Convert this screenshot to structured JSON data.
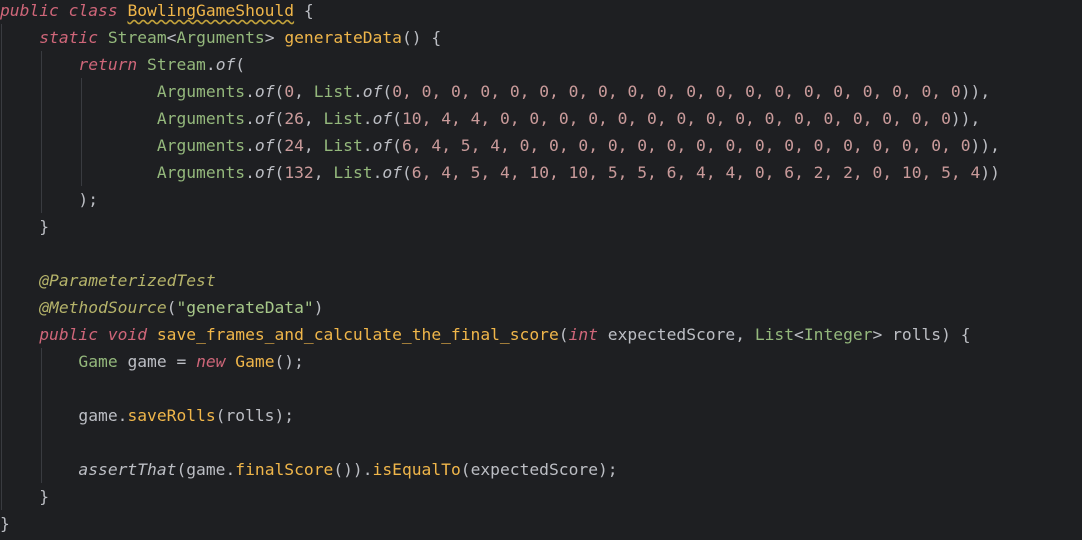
{
  "editor": {
    "colors": {
      "background": "#1e1f22",
      "plain": "#bcbec4",
      "keyword": "#cf6679",
      "type": "#94b87c",
      "method": "#f0b64a",
      "number": "#c99a9a",
      "annotation": "#b5b36a",
      "string": "#a8c98a",
      "indent_guide": "#393b40"
    },
    "lines": [
      {
        "tokens": [
          {
            "t": "public class ",
            "c": "keyword"
          },
          {
            "t": "BowlingGameShould",
            "c": "method",
            "classref": true
          },
          {
            "t": " {",
            "c": "plain"
          }
        ]
      },
      {
        "tokens": [
          {
            "t": "    ",
            "c": "plain"
          },
          {
            "t": "static ",
            "c": "keyword"
          },
          {
            "t": "Stream",
            "c": "type"
          },
          {
            "t": "<",
            "c": "plain"
          },
          {
            "t": "Arguments",
            "c": "type"
          },
          {
            "t": "> ",
            "c": "plain"
          },
          {
            "t": "generateData",
            "c": "method"
          },
          {
            "t": "() {",
            "c": "plain"
          }
        ]
      },
      {
        "tokens": [
          {
            "t": "        ",
            "c": "plain"
          },
          {
            "t": "return ",
            "c": "keyword"
          },
          {
            "t": "Stream",
            "c": "type"
          },
          {
            "t": ".",
            "c": "plain"
          },
          {
            "t": "of",
            "c": "plain",
            "italic": true
          },
          {
            "t": "(",
            "c": "plain"
          }
        ]
      },
      {
        "tokens": [
          {
            "t": "                ",
            "c": "plain"
          },
          {
            "t": "Arguments",
            "c": "type"
          },
          {
            "t": ".",
            "c": "plain"
          },
          {
            "t": "of",
            "c": "plain",
            "italic": true
          },
          {
            "t": "(",
            "c": "plain"
          },
          {
            "t": "0",
            "c": "number"
          },
          {
            "t": ", ",
            "c": "plain"
          },
          {
            "t": "List",
            "c": "type"
          },
          {
            "t": ".",
            "c": "plain"
          },
          {
            "t": "of",
            "c": "plain",
            "italic": true
          },
          {
            "t": "(",
            "c": "plain"
          },
          {
            "t": "0, 0, 0, 0, 0, 0, 0, 0, 0, 0, 0, 0, 0, 0, 0, 0, 0, 0, 0, 0",
            "c": "number"
          },
          {
            "t": ")),",
            "c": "plain"
          }
        ]
      },
      {
        "tokens": [
          {
            "t": "                ",
            "c": "plain"
          },
          {
            "t": "Arguments",
            "c": "type"
          },
          {
            "t": ".",
            "c": "plain"
          },
          {
            "t": "of",
            "c": "plain",
            "italic": true
          },
          {
            "t": "(",
            "c": "plain"
          },
          {
            "t": "26",
            "c": "number"
          },
          {
            "t": ", ",
            "c": "plain"
          },
          {
            "t": "List",
            "c": "type"
          },
          {
            "t": ".",
            "c": "plain"
          },
          {
            "t": "of",
            "c": "plain",
            "italic": true
          },
          {
            "t": "(",
            "c": "plain"
          },
          {
            "t": "10, 4, 4, 0, 0, 0, 0, 0, 0, 0, 0, 0, 0, 0, 0, 0, 0, 0, 0",
            "c": "number"
          },
          {
            "t": ")),",
            "c": "plain"
          }
        ]
      },
      {
        "tokens": [
          {
            "t": "                ",
            "c": "plain"
          },
          {
            "t": "Arguments",
            "c": "type"
          },
          {
            "t": ".",
            "c": "plain"
          },
          {
            "t": "of",
            "c": "plain",
            "italic": true
          },
          {
            "t": "(",
            "c": "plain"
          },
          {
            "t": "24",
            "c": "number"
          },
          {
            "t": ", ",
            "c": "plain"
          },
          {
            "t": "List",
            "c": "type"
          },
          {
            "t": ".",
            "c": "plain"
          },
          {
            "t": "of",
            "c": "plain",
            "italic": true
          },
          {
            "t": "(",
            "c": "plain"
          },
          {
            "t": "6, 4, 5, 4, 0, 0, 0, 0, 0, 0, 0, 0, 0, 0, 0, 0, 0, 0, 0, 0",
            "c": "number"
          },
          {
            "t": ")),",
            "c": "plain"
          }
        ]
      },
      {
        "tokens": [
          {
            "t": "                ",
            "c": "plain"
          },
          {
            "t": "Arguments",
            "c": "type"
          },
          {
            "t": ".",
            "c": "plain"
          },
          {
            "t": "of",
            "c": "plain",
            "italic": true
          },
          {
            "t": "(",
            "c": "plain"
          },
          {
            "t": "132",
            "c": "number"
          },
          {
            "t": ", ",
            "c": "plain"
          },
          {
            "t": "List",
            "c": "type"
          },
          {
            "t": ".",
            "c": "plain"
          },
          {
            "t": "of",
            "c": "plain",
            "italic": true
          },
          {
            "t": "(",
            "c": "plain"
          },
          {
            "t": "6, 4, 5, 4, 10, 10, 5, 5, 6, 4, 4, 0, 6, 2, 2, 0, 10, 5, 4",
            "c": "number"
          },
          {
            "t": "))",
            "c": "plain"
          }
        ]
      },
      {
        "tokens": [
          {
            "t": "        );",
            "c": "plain"
          }
        ]
      },
      {
        "tokens": [
          {
            "t": "    }",
            "c": "plain"
          }
        ]
      },
      {
        "tokens": []
      },
      {
        "tokens": [
          {
            "t": "    ",
            "c": "plain"
          },
          {
            "t": "@ParameterizedTest",
            "c": "annotation",
            "italic": true
          }
        ]
      },
      {
        "tokens": [
          {
            "t": "    ",
            "c": "plain"
          },
          {
            "t": "@MethodSource",
            "c": "annotation",
            "italic": true
          },
          {
            "t": "(",
            "c": "plain"
          },
          {
            "t": "\"generateData\"",
            "c": "string"
          },
          {
            "t": ")",
            "c": "plain"
          }
        ]
      },
      {
        "tokens": [
          {
            "t": "    ",
            "c": "plain"
          },
          {
            "t": "public void ",
            "c": "keyword"
          },
          {
            "t": "save_frames_and_calculate_the_final_score",
            "c": "method"
          },
          {
            "t": "(",
            "c": "plain"
          },
          {
            "t": "int ",
            "c": "keyword"
          },
          {
            "t": "expectedScore, ",
            "c": "plain"
          },
          {
            "t": "List",
            "c": "type"
          },
          {
            "t": "<",
            "c": "plain"
          },
          {
            "t": "Integer",
            "c": "type"
          },
          {
            "t": "> rolls) {",
            "c": "plain"
          }
        ]
      },
      {
        "tokens": [
          {
            "t": "        ",
            "c": "plain"
          },
          {
            "t": "Game ",
            "c": "type"
          },
          {
            "t": "game = ",
            "c": "plain"
          },
          {
            "t": "new ",
            "c": "keyword"
          },
          {
            "t": "Game",
            "c": "method"
          },
          {
            "t": "();",
            "c": "plain"
          }
        ]
      },
      {
        "tokens": []
      },
      {
        "tokens": [
          {
            "t": "        game.",
            "c": "plain"
          },
          {
            "t": "saveRolls",
            "c": "method"
          },
          {
            "t": "(rolls);",
            "c": "plain"
          }
        ]
      },
      {
        "tokens": []
      },
      {
        "tokens": [
          {
            "t": "        ",
            "c": "plain"
          },
          {
            "t": "assertThat",
            "c": "plain",
            "italic": true
          },
          {
            "t": "(game.",
            "c": "plain"
          },
          {
            "t": "finalScore",
            "c": "method"
          },
          {
            "t": "()).",
            "c": "plain"
          },
          {
            "t": "isEqualTo",
            "c": "method"
          },
          {
            "t": "(expectedScore);",
            "c": "plain"
          }
        ]
      },
      {
        "tokens": [
          {
            "t": "    }",
            "c": "plain"
          }
        ]
      },
      {
        "tokens": [
          {
            "t": "}",
            "c": "plain"
          }
        ]
      }
    ]
  }
}
